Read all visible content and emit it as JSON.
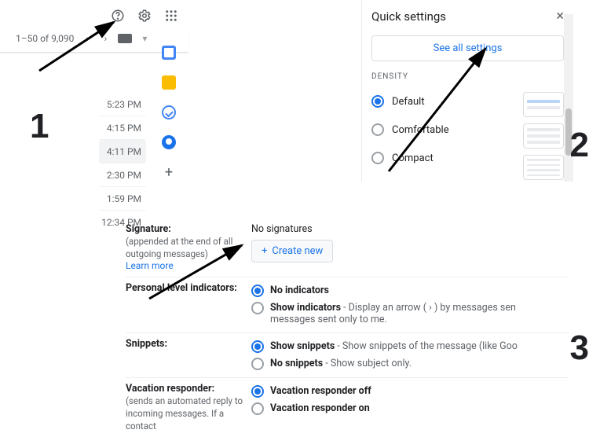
{
  "steps": {
    "one": "1",
    "two": "2",
    "three": "3"
  },
  "panel1": {
    "pager_text": "1–50 of 9,090",
    "times": [
      "5:23 PM",
      "4:15 PM",
      "4:11 PM",
      "2:30 PM",
      "1:59 PM",
      "12:34 PM"
    ],
    "selected_index": 2
  },
  "panel2": {
    "title": "Quick settings",
    "see_all": "See all settings",
    "section": "DENSITY",
    "options": [
      "Default",
      "Comfortable",
      "Compact"
    ],
    "selected_index": 0
  },
  "panel3": {
    "signature": {
      "label": "Signature:",
      "sub": "(appended at the end of all outgoing messages)",
      "learn": "Learn more",
      "status": "No signatures",
      "create": "Create new"
    },
    "pli": {
      "label": "Personal level indicators:",
      "opt1": "No indicators",
      "opt2_bold": "Show indicators",
      "opt2_rest": " - Display an arrow ( › ) by messages sen",
      "opt2_line2": "messages sent only to me."
    },
    "snippets": {
      "label": "Snippets:",
      "opt1_bold": "Show snippets",
      "opt1_rest": " - Show snippets of the message (like Goo",
      "opt2_bold": "No snippets",
      "opt2_rest": " - Show subject only."
    },
    "vacation": {
      "label": "Vacation responder:",
      "sub": "(sends an automated reply to incoming messages. If a contact",
      "opt1": "Vacation responder off",
      "opt2": "Vacation responder on"
    }
  }
}
